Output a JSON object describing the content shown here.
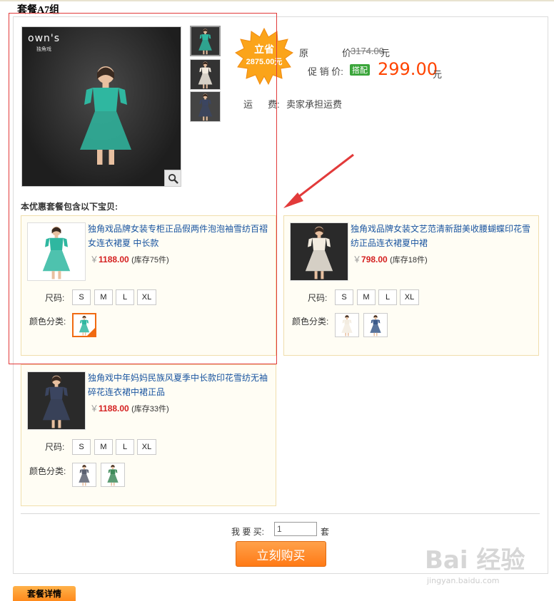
{
  "package": {
    "title": "套餐A7组",
    "brand_logo": "own's",
    "brand_sub": "独角戏"
  },
  "promo": {
    "save_label": "立省",
    "save_amount": "2875.00元"
  },
  "pricing": {
    "original_label_1": "原",
    "original_label_2": "价",
    "original_price": "3174.00",
    "original_unit": "元",
    "promo_label": "促 销 价:",
    "promo_badge": "搭配",
    "promo_price": "299.00",
    "promo_unit": "元",
    "shipping_label_1": "运",
    "shipping_label_2": "费:",
    "shipping_value": "卖家承担运费"
  },
  "section_label": "本优惠套餐包含以下宝贝:",
  "products": [
    {
      "title": "独角戏品牌女装专柜正品假两件泡泡袖雪纺百褶女连衣裙夏 中长款",
      "currency": "￥",
      "price": "1188.00",
      "stock": "(库存75件)",
      "size_label": "尺码:",
      "sizes": [
        "S",
        "M",
        "L",
        "XL"
      ],
      "color_label": "颜色分类:",
      "dress_color": "#2fb7a0"
    },
    {
      "title": "独角戏品牌女装文艺范清新甜美收腰蝴蝶印花雪纺正品连衣裙夏中裙",
      "currency": "￥",
      "price": "798.00",
      "stock": "(库存18件)",
      "size_label": "尺码:",
      "sizes": [
        "S",
        "M",
        "L",
        "XL"
      ],
      "color_label": "颜色分类:",
      "dress_color": "#f3ece0"
    },
    {
      "title": "独角戏中年妈妈民族风夏季中长款印花雪纺无袖碎花连衣裙中裙正品",
      "currency": "￥",
      "price": "1188.00",
      "stock": "(库存33件)",
      "size_label": "尺码:",
      "sizes": [
        "S",
        "M",
        "L",
        "XL"
      ],
      "color_label": "颜色分类:",
      "dress_color": "#3b4560"
    }
  ],
  "purchase": {
    "qty_label": "我 要 买:",
    "qty_value": "1",
    "qty_unit": "套",
    "buy_button": "立刻购买"
  },
  "detail_tab": "套餐详情",
  "watermark": {
    "main": "Bai 经验",
    "sub": "jingyan.baidu.com"
  },
  "colors": {
    "accent_orange": "#ff7a16",
    "price_red": "#ff4400",
    "link_blue": "#1a55a0",
    "highlight_red": "#e23a3a"
  }
}
